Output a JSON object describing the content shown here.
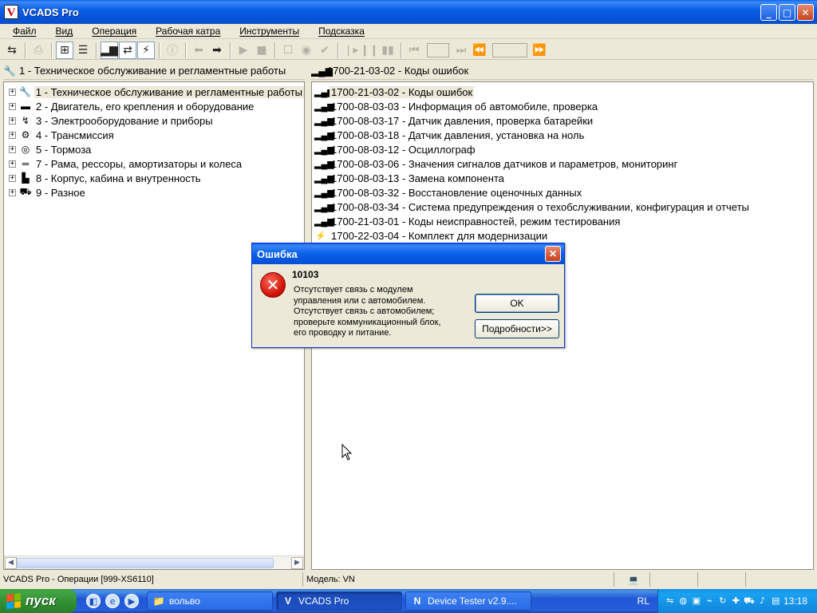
{
  "window": {
    "title": "VCADS Pro",
    "logo_letter": "V"
  },
  "menu": [
    "Файл",
    "Вид",
    "Операция",
    "Рабочая катра",
    "Инструменты",
    "Подсказка"
  ],
  "left_header": "1 - Техническое обслуживание и регламентные работы",
  "right_header": "1700-21-03-02 - Коды ошибок",
  "tree": [
    {
      "label": "1 - Техническое обслуживание и регламентные работы",
      "icon": "wrench-icon",
      "glyph": "🔧",
      "selected": true
    },
    {
      "label": "2 - Двигатель, его крепления и оборудование",
      "icon": "engine-icon",
      "glyph": "▬"
    },
    {
      "label": "3 - Электрооборудование и приборы",
      "icon": "electric-icon",
      "glyph": "↯"
    },
    {
      "label": "4 - Трансмиссия",
      "icon": "gears-icon",
      "glyph": "⚙"
    },
    {
      "label": "5 - Тормоза",
      "icon": "brake-icon",
      "glyph": "◎"
    },
    {
      "label": "7 - Рама, рессоры, амортизаторы и колеса",
      "icon": "frame-icon",
      "glyph": "═"
    },
    {
      "label": "8 - Корпус, кабина и внутренность",
      "icon": "cab-icon",
      "glyph": "▙"
    },
    {
      "label": "9 - Разное",
      "icon": "misc-icon",
      "glyph": "⛟"
    }
  ],
  "operations": [
    {
      "label": "1700-21-03-02 - Коды ошибок",
      "icon": "chart-icon",
      "glyph": "▂▄▆",
      "selected": true
    },
    {
      "label": "1700-08-03-03 - Информация об автомобиле, проверка",
      "icon": "chart-icon",
      "glyph": "▂▄▆"
    },
    {
      "label": "1700-08-03-17 - Датчик давления, проверка батарейки",
      "icon": "chart-icon",
      "glyph": "▂▄▆"
    },
    {
      "label": "1700-08-03-18 - Датчик давления, установка на ноль",
      "icon": "chart-icon",
      "glyph": "▂▄▆"
    },
    {
      "label": "1700-08-03-12 - Осциллограф",
      "icon": "chart-icon",
      "glyph": "▂▄▆"
    },
    {
      "label": "1700-08-03-06 - Значения сигналов датчиков и параметров, мониторинг",
      "icon": "chart-icon",
      "glyph": "▂▄▆"
    },
    {
      "label": "1700-08-03-13 - Замена компонента",
      "icon": "chart-icon",
      "glyph": "▂▄▆"
    },
    {
      "label": "1700-08-03-32 - Восстановление оценочных данных",
      "icon": "chart-icon",
      "glyph": "▂▄▆"
    },
    {
      "label": "1700-08-03-34 - Система предупреждения о техобслуживании, конфигурация и отчеты",
      "icon": "chart-icon",
      "glyph": "▂▄▆"
    },
    {
      "label": "1700-21-03-01 - Коды неисправностей, режим тестирования",
      "icon": "chart-icon",
      "glyph": "▂▄▆"
    },
    {
      "label": "1700-22-03-04 - Комплект для модернизации",
      "icon": "lightning-icon",
      "glyph": "⚡"
    }
  ],
  "status": {
    "left": "VCADS Pro - Операции   [999-XS6110]",
    "model": "Модель: VN"
  },
  "dialog": {
    "title": "Ошибка",
    "code": "10103",
    "message": "Отсутствует связь с модулем\nуправления или с автомобилем.\nОтсутствует связь с автомобилем;\nпроверьте коммуникационный блок,\nего проводку и питание.",
    "ok": "OK",
    "details": "Подробности>>"
  },
  "taskbar": {
    "start": "пуск",
    "tasks": [
      {
        "label": "вольво",
        "icon": "folder-icon",
        "glyph": "📁"
      },
      {
        "label": "VCADS Pro",
        "icon": "vcads-icon",
        "glyph": "V",
        "active": true
      },
      {
        "label": "Device Tester   v2.9....",
        "icon": "device-tester-icon",
        "glyph": "N"
      }
    ],
    "lang": "RL",
    "clock": "13:18"
  }
}
